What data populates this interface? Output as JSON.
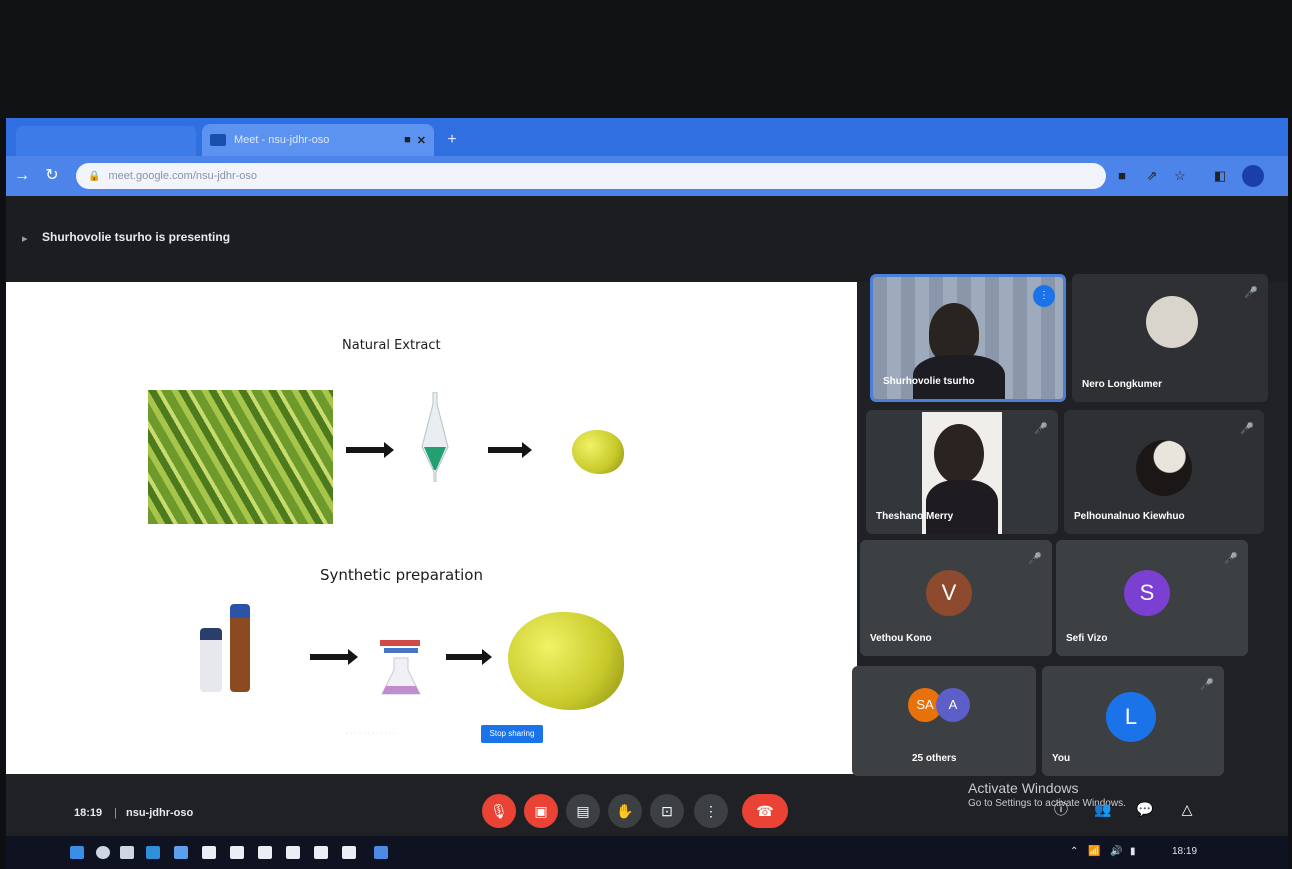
{
  "browser": {
    "active_tab_title": "Meet - nsu-jdhr-oso",
    "address": "meet.google.com/nsu-jdhr-oso"
  },
  "meet": {
    "presenting_text": "Shurhovolie tsurho is presenting",
    "slide": {
      "heading1": "Natural Extract",
      "heading2": "Synthetic preparation",
      "button_label": "Stop sharing"
    },
    "participants": [
      {
        "name": "Shurhovolie tsurho"
      },
      {
        "name": "Nero Longkumer"
      },
      {
        "name": "Theshano Merry"
      },
      {
        "name": "Pelhounalnuo Kiewhuo"
      },
      {
        "name": "Vethou Kono",
        "initial": "V",
        "color": "#8d4a2e"
      },
      {
        "name": "Sefi Vizo",
        "initial": "S",
        "color": "#7b3fd1"
      },
      {
        "name": "25 others",
        "initials": [
          "SA",
          "A"
        ],
        "colors": [
          "#e8710a",
          "#5b5fc7"
        ]
      },
      {
        "name": "You",
        "initial": "L",
        "color": "#1a73e8"
      }
    ],
    "footer": {
      "time": "18:19",
      "separator": "|",
      "meeting_code": "nsu-jdhr-oso"
    },
    "activate_windows": {
      "line1": "Activate Windows",
      "line2": "Go to Settings to activate Windows."
    }
  },
  "taskbar": {
    "clock": "18:19"
  }
}
